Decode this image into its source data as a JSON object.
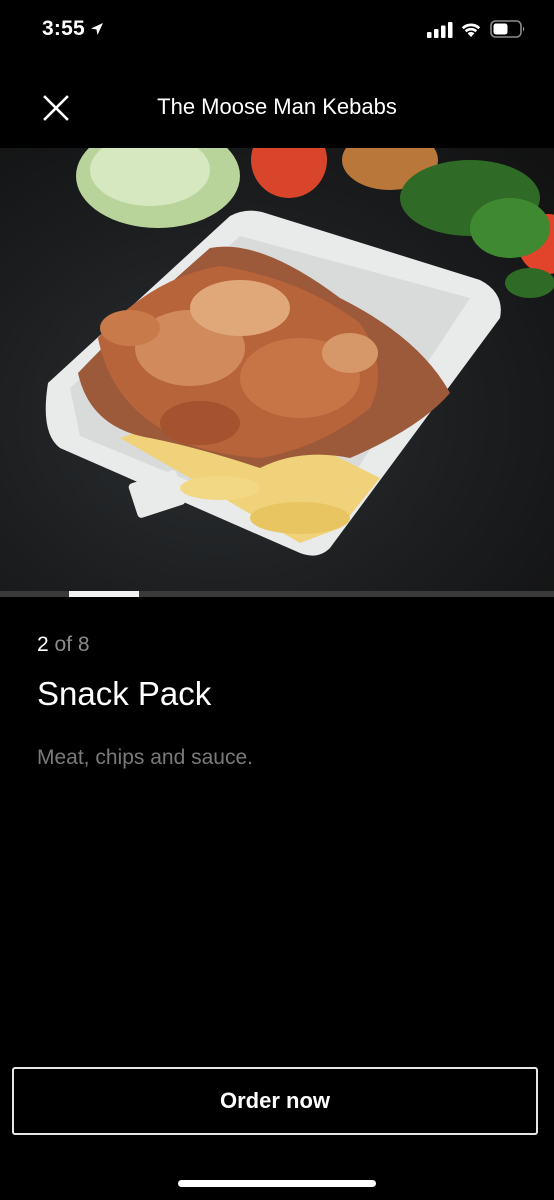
{
  "status_bar": {
    "time": "3:55",
    "icons": [
      "location-arrow-icon",
      "cellular-signal-icon",
      "wifi-icon",
      "battery-icon"
    ]
  },
  "header": {
    "close_icon": "close-icon",
    "title": "The Moose Man Kebabs"
  },
  "gallery": {
    "image_alt": "Snack Pack",
    "current_index": 2,
    "total": 8,
    "counter_current": "2",
    "counter_rest": " of 8"
  },
  "item": {
    "title": "Snack Pack",
    "description": "Meat, chips and sauce."
  },
  "actions": {
    "order_label": "Order now"
  },
  "colors": {
    "background": "#000000",
    "text": "#ffffff",
    "muted": "#7a7a7a",
    "button_border": "#e6e6e6"
  }
}
